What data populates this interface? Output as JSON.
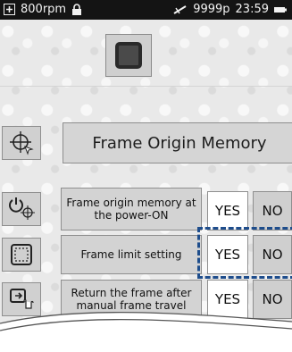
{
  "status": {
    "speed": "800rpm",
    "counter": "9999p",
    "time": "23:59"
  },
  "page": {
    "title": "Frame Origin Memory"
  },
  "rows": [
    {
      "label": "Frame origin memory at the power-ON",
      "yes": "YES",
      "no": "NO"
    },
    {
      "label": "Frame limit setting",
      "yes": "YES",
      "no": "NO"
    },
    {
      "label": "Return the frame after manual frame travel",
      "yes": "YES",
      "no": "NO"
    }
  ],
  "colors": {
    "highlight": "#1e4d8c",
    "statusbar": "#141414"
  },
  "icons": [
    "plus-box-icon",
    "lock-icon",
    "needle-icon",
    "battery-icon",
    "stop-square-icon",
    "frame-origin-icon",
    "power-frame-icon",
    "frame-limit-icon",
    "manual-travel-icon"
  ]
}
